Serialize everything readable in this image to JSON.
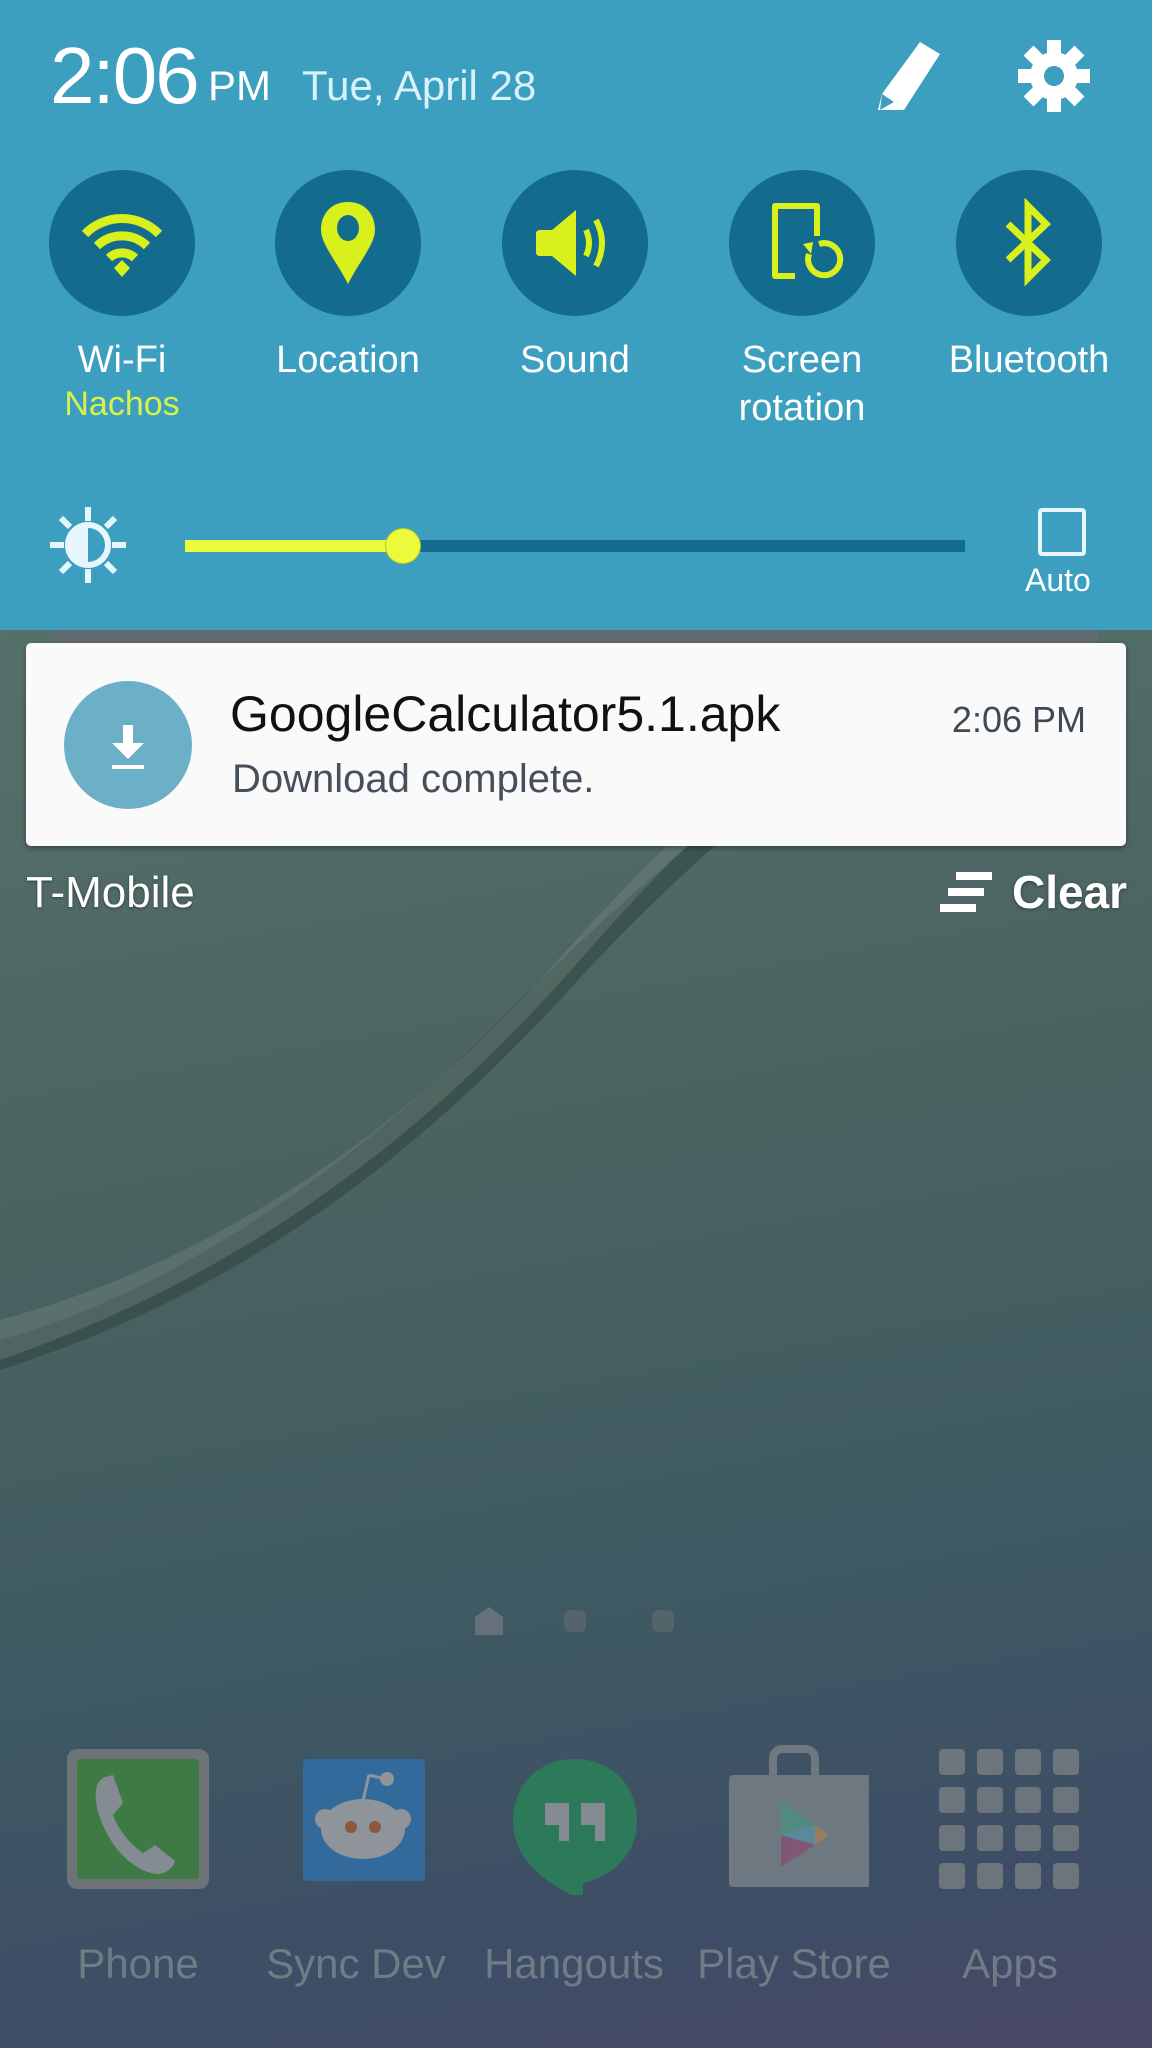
{
  "status_header": {
    "time": "2:06",
    "ampm": "PM",
    "date": "Tue, April 28",
    "edit_icon": "pencil-icon",
    "settings_icon": "gear-icon"
  },
  "quick_toggles": [
    {
      "id": "wifi",
      "label": "Wi-Fi",
      "sublabel": "Nachos",
      "icon": "wifi-icon",
      "active": true
    },
    {
      "id": "location",
      "label": "Location",
      "icon": "location-pin-icon",
      "active": true
    },
    {
      "id": "sound",
      "label": "Sound",
      "icon": "speaker-icon",
      "active": true
    },
    {
      "id": "rotation",
      "label": "Screen rotation",
      "icon": "screen-rotation-icon",
      "active": true
    },
    {
      "id": "bluetooth",
      "label": "Bluetooth",
      "icon": "bluetooth-icon",
      "active": true
    }
  ],
  "brightness": {
    "icon": "brightness-icon",
    "level": 0.28,
    "auto_label": "Auto",
    "auto_checked": false
  },
  "notifications": [
    {
      "icon": "download-icon",
      "title": "GoogleCalculator5.1.apk",
      "text": "Download complete.",
      "time": "2:06 PM"
    }
  ],
  "footer": {
    "carrier": "T-Mobile",
    "clear_label": "Clear",
    "clear_icon": "clear-all-icon"
  },
  "home_screen": {
    "page_indicators": [
      "home",
      "page",
      "page"
    ],
    "dock": [
      {
        "label": "Phone",
        "icon": "phone-icon"
      },
      {
        "label": "Sync Dev",
        "icon": "reddit-alien-icon"
      },
      {
        "label": "Hangouts",
        "icon": "hangouts-icon"
      },
      {
        "label": "Play Store",
        "icon": "play-store-icon"
      },
      {
        "label": "Apps",
        "icon": "apps-grid-icon"
      }
    ]
  },
  "colors": {
    "panel_bg": "#3c9fc0",
    "toggle_circle": "#136b8d",
    "accent": "#ecfa3c",
    "notification_bg": "#fafafa"
  }
}
